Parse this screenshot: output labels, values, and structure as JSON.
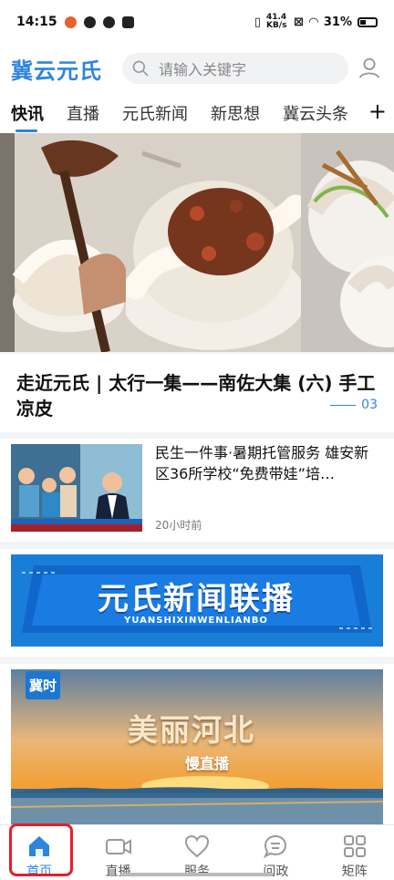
{
  "status": {
    "time": "14:15",
    "network_speed": "41.4 KB/s",
    "battery": "31%",
    "app_indicators": [
      "weibo-icon",
      "lightbulb-icon",
      "tiktok-icon",
      "grid-icon"
    ]
  },
  "header": {
    "logo": "冀云元氏",
    "search_placeholder": "请输入关键字"
  },
  "tabs": [
    {
      "label": "快讯",
      "active": true
    },
    {
      "label": "直播"
    },
    {
      "label": "元氏新闻"
    },
    {
      "label": "新思想"
    },
    {
      "label": "冀云头条"
    }
  ],
  "hero": {
    "title": "走近元氏 | 太行一集——南佐大集 (六) 手工凉皮",
    "page": "03"
  },
  "news": [
    {
      "title": "民生一件事·暑期托管服务 雄安新区36所学校“免费带娃”培…",
      "time": "20小时前"
    }
  ],
  "banner": {
    "title": "元氏新闻联播",
    "subtitle": "YUANSHIXINWENLIANBO"
  },
  "live_card": {
    "brand": "冀时",
    "title": "美丽河北",
    "subtitle": "慢直播"
  },
  "bottom_nav": [
    {
      "label": "首页",
      "icon": "home-icon",
      "active": true
    },
    {
      "label": "直播",
      "icon": "video-icon"
    },
    {
      "label": "服务",
      "icon": "heart-icon"
    },
    {
      "label": "问政",
      "icon": "chat-icon"
    },
    {
      "label": "矩阵",
      "icon": "grid-icon"
    }
  ],
  "colors": {
    "accent": "#2d86dd",
    "highlight": "#e41f2b"
  }
}
